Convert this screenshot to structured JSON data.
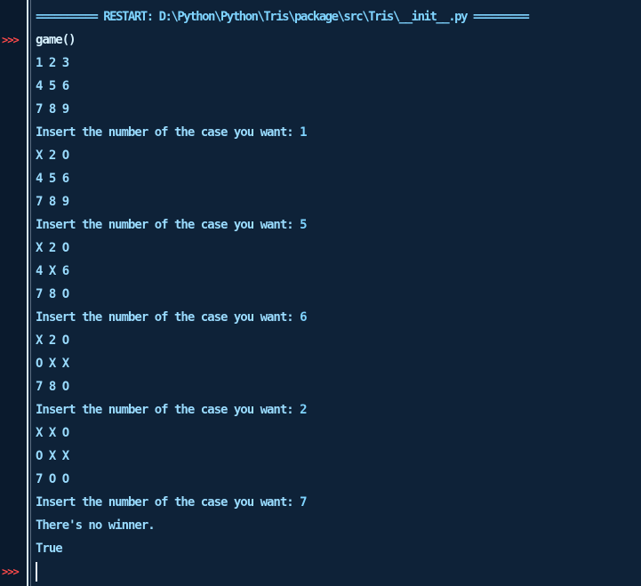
{
  "shell": {
    "prompt_symbol": ">>>",
    "restart_line": "========== RESTART: D:\\Python\\Python\\Tris\\package\\src\\Tris\\__init__.py =========",
    "command": "game()",
    "lines": [
      {
        "kind": "stdout",
        "text": "1 2 3"
      },
      {
        "kind": "stdout",
        "text": "4 5 6"
      },
      {
        "kind": "stdout",
        "text": "7 8 9"
      },
      {
        "kind": "stdout",
        "text": "Insert the number of the case you want: ",
        "answer": "1"
      },
      {
        "kind": "stdout",
        "text": "X 2 O"
      },
      {
        "kind": "stdout",
        "text": "4 5 6"
      },
      {
        "kind": "stdout",
        "text": "7 8 9"
      },
      {
        "kind": "stdout",
        "text": "Insert the number of the case you want: ",
        "answer": "5"
      },
      {
        "kind": "stdout",
        "text": "X 2 O"
      },
      {
        "kind": "stdout",
        "text": "4 X 6"
      },
      {
        "kind": "stdout",
        "text": "7 8 O"
      },
      {
        "kind": "stdout",
        "text": "Insert the number of the case you want: ",
        "answer": "6"
      },
      {
        "kind": "stdout",
        "text": "X 2 O"
      },
      {
        "kind": "stdout",
        "text": "O X X"
      },
      {
        "kind": "stdout",
        "text": "7 8 O"
      },
      {
        "kind": "stdout",
        "text": "Insert the number of the case you want: ",
        "answer": "2"
      },
      {
        "kind": "stdout",
        "text": "X X O"
      },
      {
        "kind": "stdout",
        "text": "O X X"
      },
      {
        "kind": "stdout",
        "text": "7 O O"
      },
      {
        "kind": "stdout",
        "text": "Insert the number of the case you want: ",
        "answer": "7"
      },
      {
        "kind": "stdout",
        "text": "There's no winner."
      },
      {
        "kind": "result",
        "text": "True"
      }
    ]
  },
  "colors": {
    "background": "#0e2238",
    "gutter": "#0a1a2d",
    "prompt": "#ff4a4a",
    "text": "#9adcff"
  }
}
